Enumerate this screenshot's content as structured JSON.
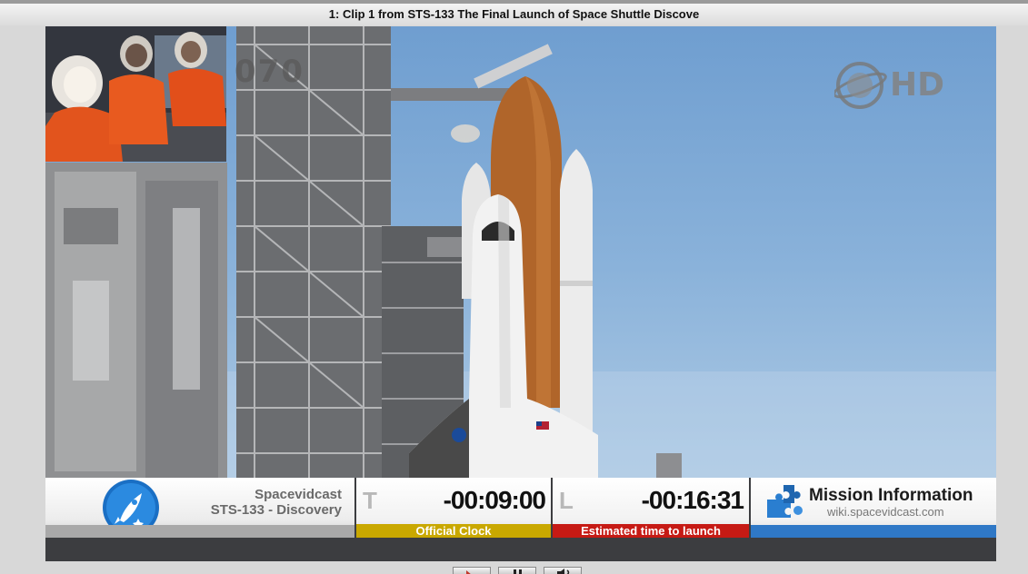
{
  "window": {
    "title": "1: Clip 1 from STS-133 The Final Launch of Space Shuttle Discove"
  },
  "video": {
    "pip_clock": "070",
    "hd_label": "HD",
    "overlay": {
      "brand": {
        "name": "Spacevidcast",
        "subtitle": "STS-133 - Discovery",
        "logo_icon": "rocket-icon"
      },
      "official_clock": {
        "letter": "T",
        "value": "-00:09:00",
        "caption": "Official Clock",
        "caption_color": "#c9a800"
      },
      "launch_clock": {
        "letter": "L",
        "value": "-00:16:31",
        "caption": "Estimated time to launch",
        "caption_color": "#c61a14"
      },
      "mission": {
        "title": "Mission Information",
        "url": "wiki.spacevidcast.com",
        "accent_color": "#2f78c6"
      }
    }
  },
  "controls": {
    "icons": [
      "play-icon",
      "pause-icon",
      "volume-icon"
    ]
  }
}
